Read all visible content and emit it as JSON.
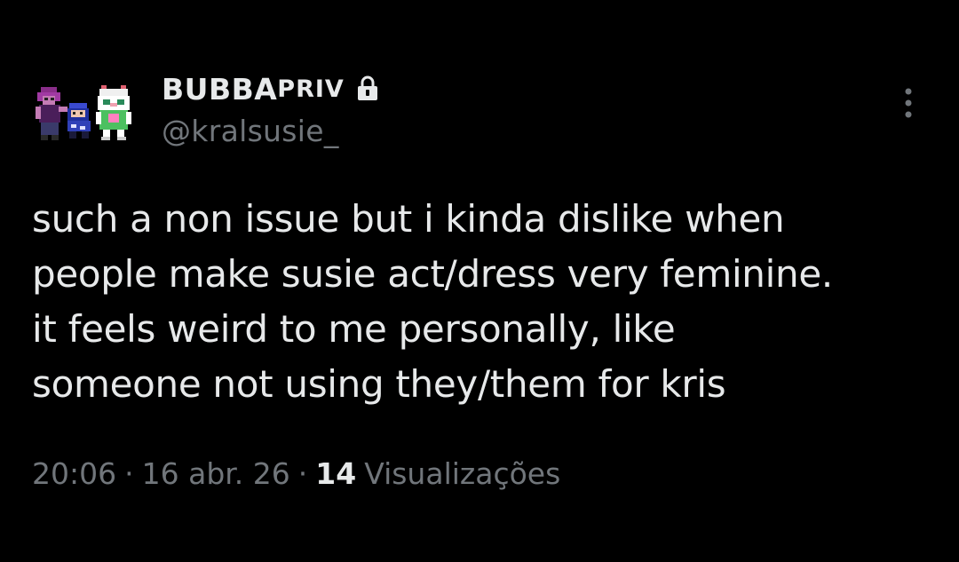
{
  "tweet": {
    "display_name_main": "BUBBA",
    "display_name_suffix": "PRIV",
    "handle": "@kralsusie_",
    "text": "such a non issue but i kinda dislike when\npeople make susie act/dress very feminine.\nit feels weird to me personally, like\nsomeone not using they/them for kris",
    "time": "20:06",
    "date": "16 abr. 26",
    "views_count": "14",
    "views_label": "Visualizações",
    "separator": "·",
    "icons": {
      "lock": "lock-icon",
      "more": "more-vertical-icon",
      "avatar": "pixel-art-avatar"
    },
    "colors": {
      "background": "#000000",
      "primary_text": "#e7e9ea",
      "secondary_text": "#71767b"
    }
  }
}
